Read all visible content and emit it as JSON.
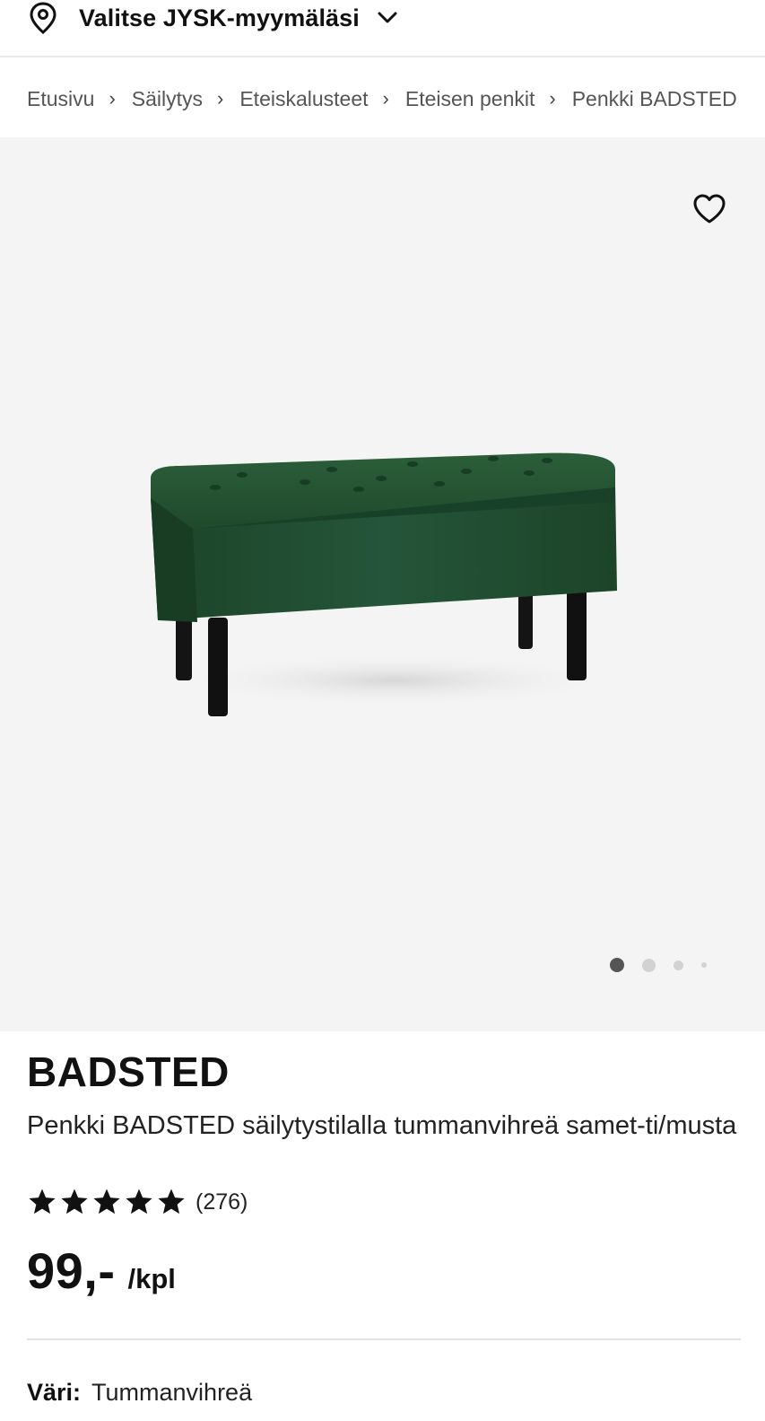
{
  "store_bar": {
    "label": "Valitse JYSK-myymäläsi",
    "icon": "location-pin-icon",
    "dropdown_icon": "chevron-down-icon"
  },
  "breadcrumb": {
    "items": [
      "Etusivu",
      "Säilytys",
      "Eteiskalusteet",
      "Eteisen penkit",
      "Penkki BADSTED"
    ],
    "separator": "›"
  },
  "gallery": {
    "favorite_icon": "heart-icon",
    "image_count": 4,
    "active_index": 0,
    "product_color": "#1f4a2c"
  },
  "product": {
    "name": "BADSTED",
    "description": "Penkki BADSTED säilytystilalla tummanvihreä samet-ti/musta",
    "rating": 5,
    "review_count": "(276)",
    "price": "99,-",
    "price_unit": "/kpl"
  },
  "color": {
    "label": "Väri:",
    "value": "Tummanvihreä"
  }
}
